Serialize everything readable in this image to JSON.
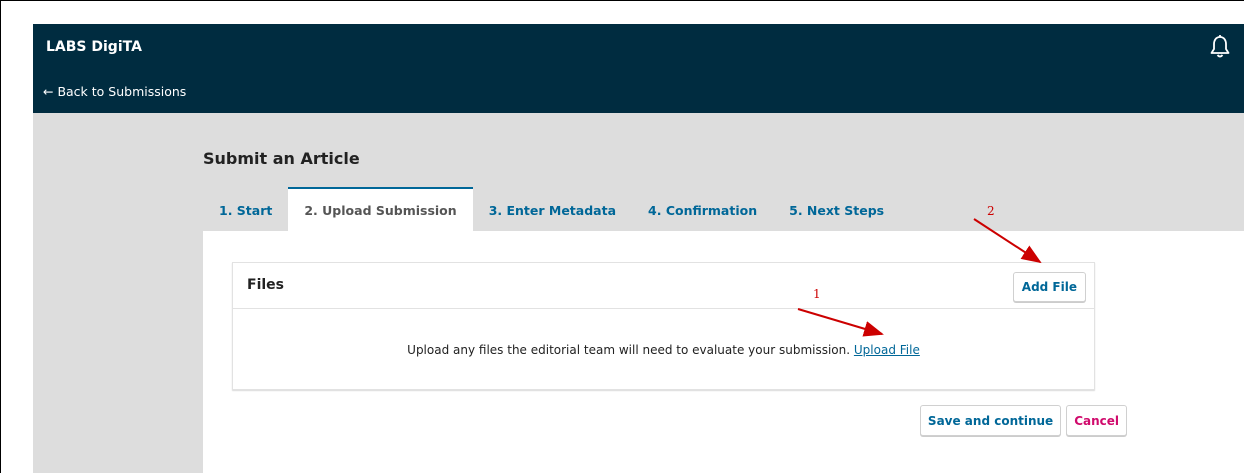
{
  "header": {
    "site_name": "LABS DigiTA",
    "back_link": "← Back to Submissions",
    "bell_icon": "bell-icon"
  },
  "main": {
    "page_title": "Submit an Article",
    "tabs": [
      {
        "label": "1. Start",
        "active": false
      },
      {
        "label": "2. Upload Submission",
        "active": true
      },
      {
        "label": "3. Enter Metadata",
        "active": false
      },
      {
        "label": "4. Confirmation",
        "active": false
      },
      {
        "label": "5. Next Steps",
        "active": false
      }
    ],
    "files": {
      "title": "Files",
      "add_button": "Add File",
      "message": "Upload any files the editorial team will need to evaluate your submission.",
      "upload_link": "Upload File"
    },
    "actions": {
      "save_label": "Save and continue",
      "cancel_label": "Cancel"
    }
  },
  "annotations": {
    "marker_1": "1",
    "marker_2": "2",
    "color": "#cc0000"
  },
  "colors": {
    "header_bg": "#002c40",
    "link": "#006798",
    "cancel": "#d00a6c",
    "page_bg": "#dddddd"
  }
}
